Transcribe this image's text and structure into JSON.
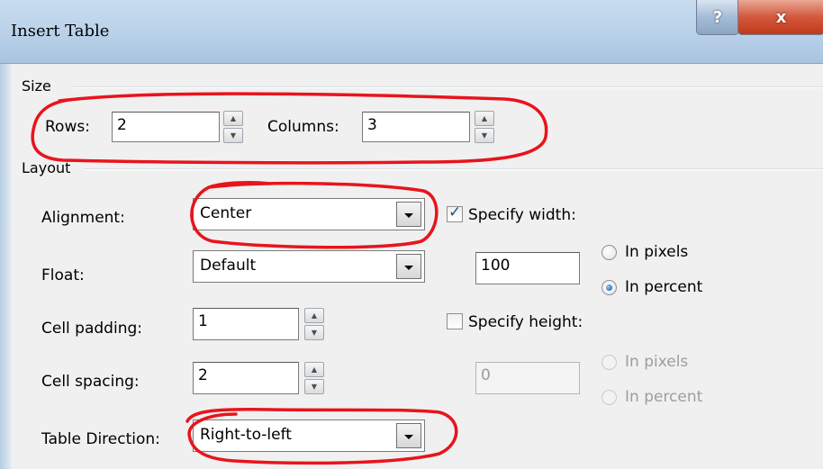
{
  "window": {
    "title": "Insert Table",
    "help_glyph": "?",
    "close_glyph": "x"
  },
  "size": {
    "group_label": "Size",
    "rows_label": "Rows:",
    "rows_value": "2",
    "columns_label": "Columns:",
    "columns_value": "3"
  },
  "layout": {
    "group_label": "Layout",
    "alignment_label": "Alignment:",
    "alignment_value": "Center",
    "float_label": "Float:",
    "float_value": "Default",
    "cell_padding_label": "Cell padding:",
    "cell_padding_value": "1",
    "cell_spacing_label": "Cell spacing:",
    "cell_spacing_value": "2",
    "direction_label": "Table Direction:",
    "direction_value": "Right-to-left",
    "specify_width_label": "Specify width:",
    "specify_width_checked": true,
    "width_value": "100",
    "width_in_pixels_label": "In pixels",
    "width_in_percent_label": "In percent",
    "width_unit_selected": "In percent",
    "specify_height_label": "Specify height:",
    "specify_height_checked": false,
    "height_value": "0",
    "height_in_pixels_label": "In pixels",
    "height_in_percent_label": "In percent"
  },
  "annotation_color": "#e8141c",
  "icons": {
    "help": "question-icon",
    "close": "close-icon",
    "spin_up": "up-arrow-icon",
    "spin_down": "down-arrow-icon",
    "dropdown": "chevron-down-icon",
    "checkmark": "checkmark-icon"
  }
}
